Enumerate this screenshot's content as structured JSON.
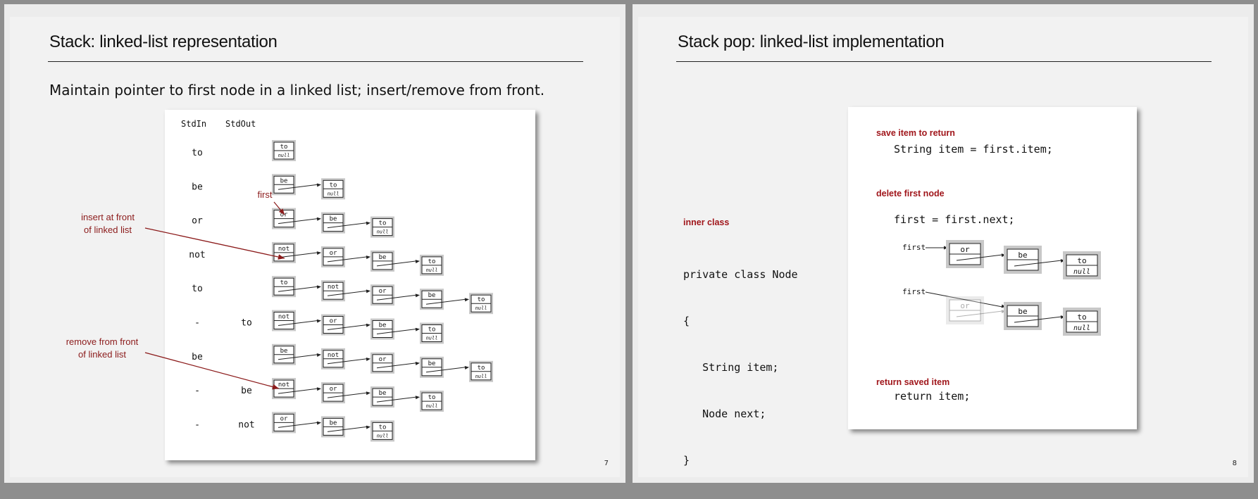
{
  "slide7": {
    "title": "Stack:  linked-list representation",
    "subtitle": "Maintain pointer to first node in a linked list; insert/remove from front.",
    "page_number": "7",
    "col_stdin": "StdIn",
    "col_stdout": "StdOut",
    "first_label": "first",
    "annot_insert_l1": "insert at front",
    "annot_insert_l2": "of linked list",
    "annot_remove_l1": "remove from front",
    "annot_remove_l2": "of linked list",
    "null_text": "null",
    "rows": [
      {
        "stdin": "to",
        "stdout": "",
        "nodes": [
          "to"
        ]
      },
      {
        "stdin": "be",
        "stdout": "",
        "nodes": [
          "be",
          "to"
        ]
      },
      {
        "stdin": "or",
        "stdout": "",
        "nodes": [
          "or",
          "be",
          "to"
        ]
      },
      {
        "stdin": "not",
        "stdout": "",
        "nodes": [
          "not",
          "or",
          "be",
          "to"
        ]
      },
      {
        "stdin": "to",
        "stdout": "",
        "nodes": [
          "to",
          "not",
          "or",
          "be",
          "to"
        ]
      },
      {
        "stdin": "-",
        "stdout": "to",
        "nodes": [
          "not",
          "or",
          "be",
          "to"
        ]
      },
      {
        "stdin": "be",
        "stdout": "",
        "nodes": [
          "be",
          "not",
          "or",
          "be",
          "to"
        ]
      },
      {
        "stdin": "-",
        "stdout": "be",
        "nodes": [
          "not",
          "or",
          "be",
          "to"
        ]
      },
      {
        "stdin": "-",
        "stdout": "not",
        "nodes": [
          "or",
          "be",
          "to"
        ]
      }
    ]
  },
  "slide8": {
    "title": "Stack pop:  linked-list implementation",
    "page_number": "8",
    "inner_class_label": "inner class",
    "code_line1": "private class Node",
    "code_line2": "{",
    "code_line3": "   String item;",
    "code_line4": "   Node next;",
    "code_line5": "}",
    "save_label": "save item to return",
    "save_code": "String item = first.item;",
    "delete_label": "delete first node",
    "delete_code": "first = first.next;",
    "return_label": "return saved item",
    "return_code": "return item;",
    "first_label_a": "first",
    "first_label_b": "first",
    "diagram_a_nodes": [
      "or",
      "be",
      "to"
    ],
    "diagram_b_nodes": [
      "or",
      "be",
      "to"
    ],
    "null_text": "null"
  },
  "colors": {
    "accent_red": "#a0161b",
    "node_gray": "#c8c8c8"
  }
}
